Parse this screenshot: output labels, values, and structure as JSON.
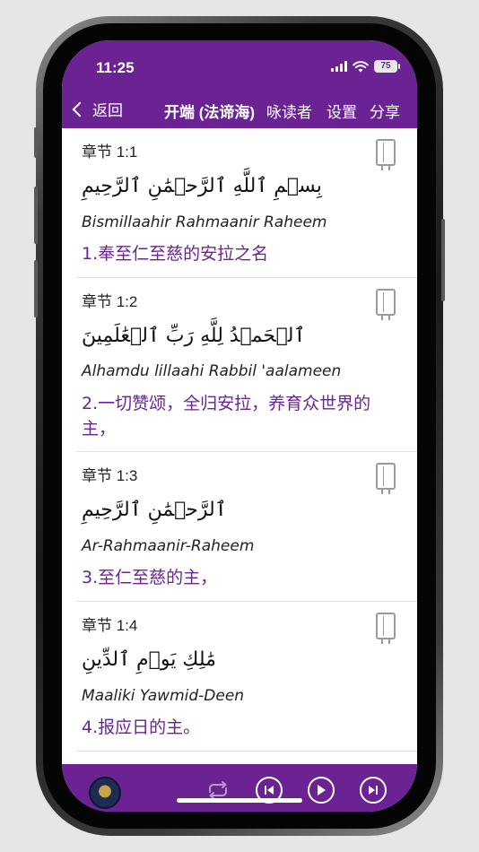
{
  "status_bar": {
    "time": "11:25",
    "battery": "75"
  },
  "nav": {
    "back_label": "返回",
    "title": "开端 (法谛海)",
    "reciter_label": "咏读者",
    "settings_label": "设置",
    "share_label": "分享"
  },
  "verses": [
    {
      "number": "章节 1:1",
      "arabic": "بِسۡمِ ٱللَّهِ ٱلرَّحۡمَٰنِ ٱلرَّحِيمِ",
      "transliteration": "Bismillaahir Rahmaanir Raheem",
      "translation": "1.奉至仁至慈的安拉之名"
    },
    {
      "number": "章节 1:2",
      "arabic": "ٱلۡحَمۡدُ لِلَّهِ رَبِّ ٱلۡعَٰلَمِينَ",
      "transliteration": "Alhamdu lillaahi Rabbil 'aalameen",
      "translation": "2.一切赞颂，全归安拉，养育众世界的主，"
    },
    {
      "number": "章节 1:3",
      "arabic": "ٱلرَّحۡمَٰنِ ٱلرَّحِيمِ",
      "transliteration": "Ar-Rahmaanir-Raheem",
      "translation": "3.至仁至慈的主，"
    },
    {
      "number": "章节 1:4",
      "arabic": "مَٰلِكِ يَوۡمِ ٱلدِّينِ",
      "transliteration": "Maaliki Yawmid-Deen",
      "translation": "4.报应日的主。"
    }
  ],
  "icons": {
    "back": "chevron-left-icon",
    "bookmark": "book-icon",
    "repeat": "repeat-icon",
    "previous": "skip-previous-icon",
    "play": "play-icon",
    "next": "skip-next-icon",
    "signal": "cellular-signal-icon",
    "wifi": "wifi-icon",
    "battery": "battery-icon"
  },
  "colors": {
    "accent": "#6b2394",
    "translation_text": "#6b2394",
    "background": "#ffffff"
  }
}
